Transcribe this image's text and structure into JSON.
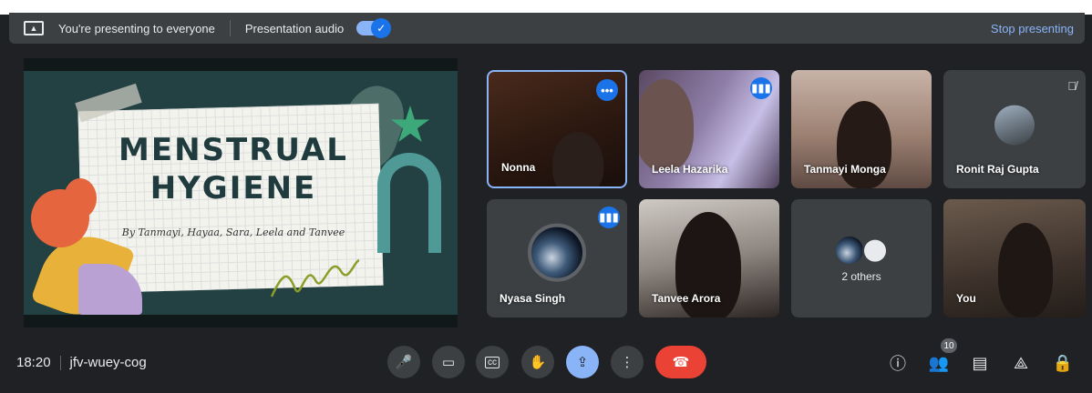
{
  "banner": {
    "presenting_text": "You're presenting to everyone",
    "audio_label": "Presentation audio",
    "stop_label": "Stop presenting"
  },
  "slide": {
    "title_line1": "MENSTRUAL",
    "title_line2": "HYGIENE",
    "subtitle": "By Tanmayi, Hayaa, Sara, Leela and Tanvee"
  },
  "participants": [
    {
      "name": "Nonna",
      "status_icon": "more-icon"
    },
    {
      "name": "Leela Hazarika",
      "status_icon": "speaking-icon"
    },
    {
      "name": "Tanmayi Monga",
      "status_icon": ""
    },
    {
      "name": "Ronit Raj Gupta",
      "status_icon": "mic-off-icon"
    },
    {
      "name": "Nyasa Singh",
      "status_icon": "speaking-icon"
    },
    {
      "name": "Tanvee Arora",
      "status_icon": ""
    },
    {
      "name": "2 others",
      "status_icon": ""
    },
    {
      "name": "You",
      "status_icon": ""
    }
  ],
  "meeting": {
    "time": "18:20",
    "code": "jfv-wuey-cog"
  },
  "controls": [
    "mic-icon",
    "camera-icon",
    "captions-icon",
    "raise-hand-icon",
    "present-icon",
    "more-options-icon",
    "end-call-icon"
  ],
  "right_controls": {
    "people_count": "10",
    "icons": [
      "info-icon",
      "people-icon",
      "chat-icon",
      "activities-icon",
      "host-controls-icon"
    ]
  },
  "colors": {
    "background": "#202124",
    "accent": "#8ab4f8",
    "badge_blue": "#1a73e8",
    "end_call": "#ea4335"
  }
}
